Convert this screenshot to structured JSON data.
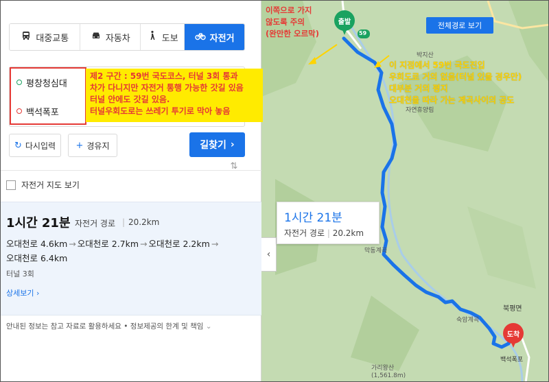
{
  "tabs": [
    {
      "label": "대중교통",
      "icon": "bus-icon",
      "active": false
    },
    {
      "label": "자동차",
      "icon": "car-icon",
      "active": false
    },
    {
      "label": "도보",
      "icon": "walk-icon",
      "active": false
    },
    {
      "label": "자전거",
      "icon": "bicycle-icon",
      "active": true
    }
  ],
  "route_inputs": {
    "start": "평창청심대",
    "end": "백석폭포"
  },
  "buttons": {
    "reset": "다시입력",
    "waypoint": "경유지",
    "search": "길찾기"
  },
  "bike_map_toggle": "자전거 지도 보기",
  "result": {
    "duration": "1시간 21분",
    "route_type": "자전거 경로",
    "distance": "20.2km",
    "segments": [
      "오대천로 4.6km",
      "오대천로 2.7km",
      "오대천로 2.2km",
      "오대천로 6.4km"
    ],
    "tunnel": "터널 3회",
    "detail_link": "상세보기"
  },
  "footer": {
    "disclaimer": "안내된 정보는 참고 자료로 활용하세요",
    "limits": "정보제공의 한계 및 책임"
  },
  "map": {
    "whole_route_button": "전체경로 보기",
    "start_pin": "출발",
    "end_pin": "도착",
    "road_badge": "59",
    "labels": [
      "박지산",
      "자연휴양림",
      "숙암계곡",
      "북평면",
      "가리왕산",
      "(1,561.8m)",
      "백석폭포",
      "막동계곡"
    ],
    "info_card": {
      "duration": "1시간 21분",
      "route_type": "자전거 경로",
      "distance": "20.2km"
    }
  },
  "annotations": {
    "left_box": [
      "제2 구간 : 59번 국도코스, 터널 3회 통과",
      "차가 다니지만 자전거 통행 가능한 갓길 있음",
      "터널 안에도 갓길 있음.",
      "터널우회도로는 쓰레기 투기로 막아 놓음"
    ],
    "top_map": [
      "이쪽으로 가지",
      "않도록 주의",
      "(완만한 오르막)"
    ],
    "right_map": [
      "이 지점에서 59번 국도진입",
      "우회도로 거의 없음(터널 있을 경우만)",
      "대부분 거의 평지",
      "오대천을 따라 가는 계곡사이의 공도"
    ]
  },
  "colors": {
    "accent": "#1a73e8",
    "route": "#1a73e8",
    "annotation_red": "#e53935",
    "annotation_yellow": "#ffd400",
    "highlight": "#ffeb00"
  }
}
